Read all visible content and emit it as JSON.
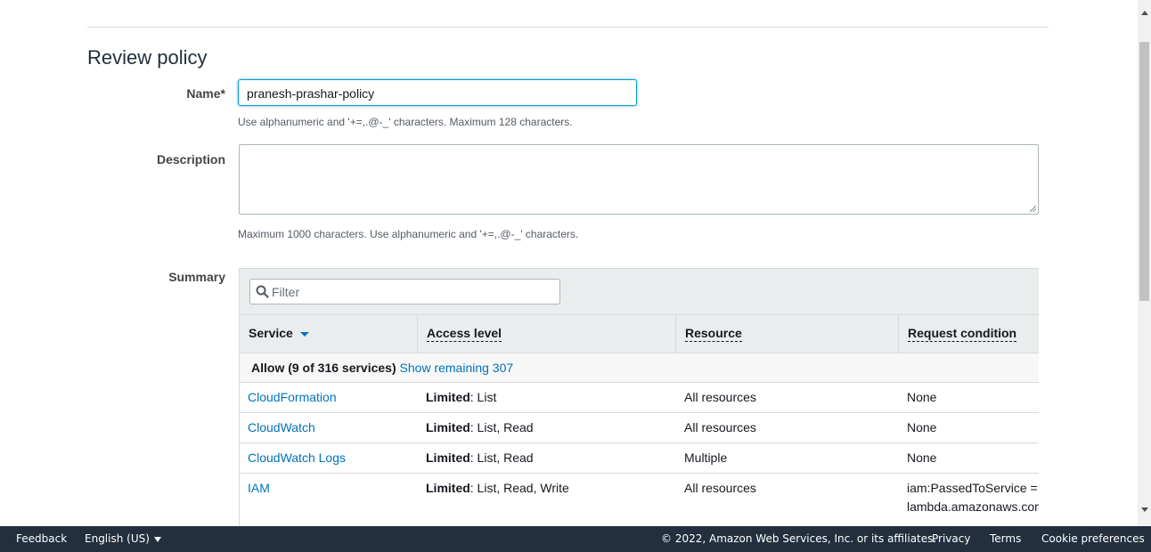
{
  "page_title": "Review policy",
  "name_field": {
    "label": "Name*",
    "value": "pranesh-prashar-policy",
    "help": "Use alphanumeric and '+=,.@-_' characters. Maximum 128 characters."
  },
  "description_field": {
    "label": "Description",
    "value": "",
    "help": "Maximum 1000 characters. Use alphanumeric and '+=,.@-_' characters."
  },
  "summary": {
    "label": "Summary",
    "filter_placeholder": "Filter",
    "columns": [
      "Service",
      "Access level",
      "Resource",
      "Request condition"
    ],
    "group": {
      "title": "Allow (9 of 316 services)",
      "link": "Show remaining 307"
    },
    "rows": [
      {
        "service": "CloudFormation",
        "access_bold": "Limited",
        "access_rest": ": List",
        "resource": "All resources",
        "condition": "None"
      },
      {
        "service": "CloudWatch",
        "access_bold": "Limited",
        "access_rest": ": List, Read",
        "resource": "All resources",
        "condition": "None"
      },
      {
        "service": "CloudWatch Logs",
        "access_bold": "Limited",
        "access_rest": ": List, Read",
        "resource": "Multiple",
        "condition": "None"
      },
      {
        "service": "IAM",
        "access_bold": "Limited",
        "access_rest": ": List, Read, Write",
        "resource": "All resources",
        "condition_line1": "iam:PassedToService =",
        "condition_line2": "lambda.amazonaws.com"
      }
    ]
  },
  "footer": {
    "feedback": "Feedback",
    "language": "English (US)",
    "copyright": "© 2022, Amazon Web Services, Inc. or its affiliates.",
    "privacy": "Privacy",
    "terms": "Terms",
    "cookie": "Cookie preferences"
  },
  "colors": {
    "link": "#0073bb",
    "footer_bg": "#232f3e",
    "header_bg": "#eaeded"
  }
}
